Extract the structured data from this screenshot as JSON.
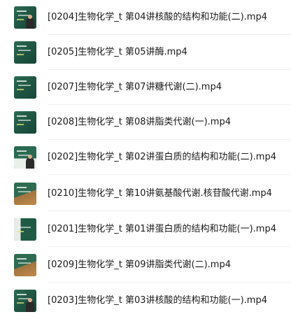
{
  "files": [
    {
      "name": "[0204]生物化学_t 第04讲核酸的结构和功能(二).mp4",
      "thumbnail_icon": "video-thumbnail-icon"
    },
    {
      "name": "[0205]生物化学_t 第05讲酶.mp4",
      "thumbnail_icon": "video-thumbnail-icon"
    },
    {
      "name": "[0207]生物化学_t 第07讲糖代谢(二).mp4",
      "thumbnail_icon": "video-thumbnail-icon"
    },
    {
      "name": "[0208]生物化学_t 第08讲脂类代谢(一).mp4",
      "thumbnail_icon": "video-thumbnail-icon"
    },
    {
      "name": "[0202]生物化学_t 第02讲蛋白质的结构和功能(二).mp4",
      "thumbnail_icon": "video-thumbnail-icon"
    },
    {
      "name": "[0210]生物化学_t 第10讲氨基酸代谢.核苷酸代谢.mp4",
      "thumbnail_icon": "video-thumbnail-icon"
    },
    {
      "name": "[0201]生物化学_t 第01讲蛋白质的结构和功能(一).mp4",
      "thumbnail_icon": "video-thumbnail-icon"
    },
    {
      "name": "[0209]生物化学_t 第09讲脂类代谢(二).mp4",
      "thumbnail_icon": "video-thumbnail-icon"
    },
    {
      "name": "[0203]生物化学_t 第03讲核酸的结构和功能(一).mp4",
      "thumbnail_icon": "video-thumbnail-icon"
    }
  ],
  "colors": {
    "text": "#1a1a1a",
    "divider": "#efefef",
    "thumbnail_board": "#1f5a45"
  }
}
